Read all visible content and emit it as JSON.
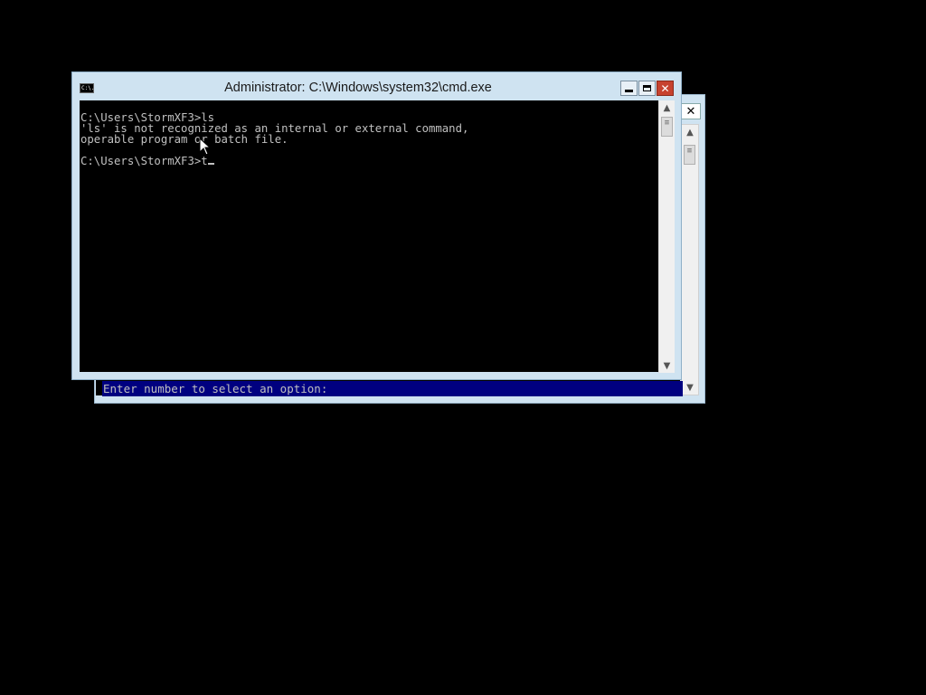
{
  "background_window": {
    "close_glyph": "✕",
    "prompt_text": "Enter number to select an option:",
    "scroll_up_glyph": "▲",
    "scroll_down_glyph": "▼",
    "thumb_glyph": "≡"
  },
  "cmd_window": {
    "title": "Administrator: C:\\Windows\\system32\\cmd.exe",
    "icon_text": "C:\\.",
    "close_glyph": "✕",
    "lines": [
      "C:\\Users\\StormXF3>ls",
      "'ls' is not recognized as an internal or external command,",
      "operable program or batch file.",
      "",
      "C:\\Users\\StormXF3>t"
    ],
    "scroll_up_glyph": "▲",
    "scroll_down_glyph": "▼",
    "thumb_glyph": "≡"
  },
  "colors": {
    "desktop": "#000000",
    "window_frame": "#cfe3f1",
    "console_bg": "#000000",
    "console_text": "#c0c0c0",
    "menu_highlight": "#000080",
    "close_button": "#c7422f"
  }
}
